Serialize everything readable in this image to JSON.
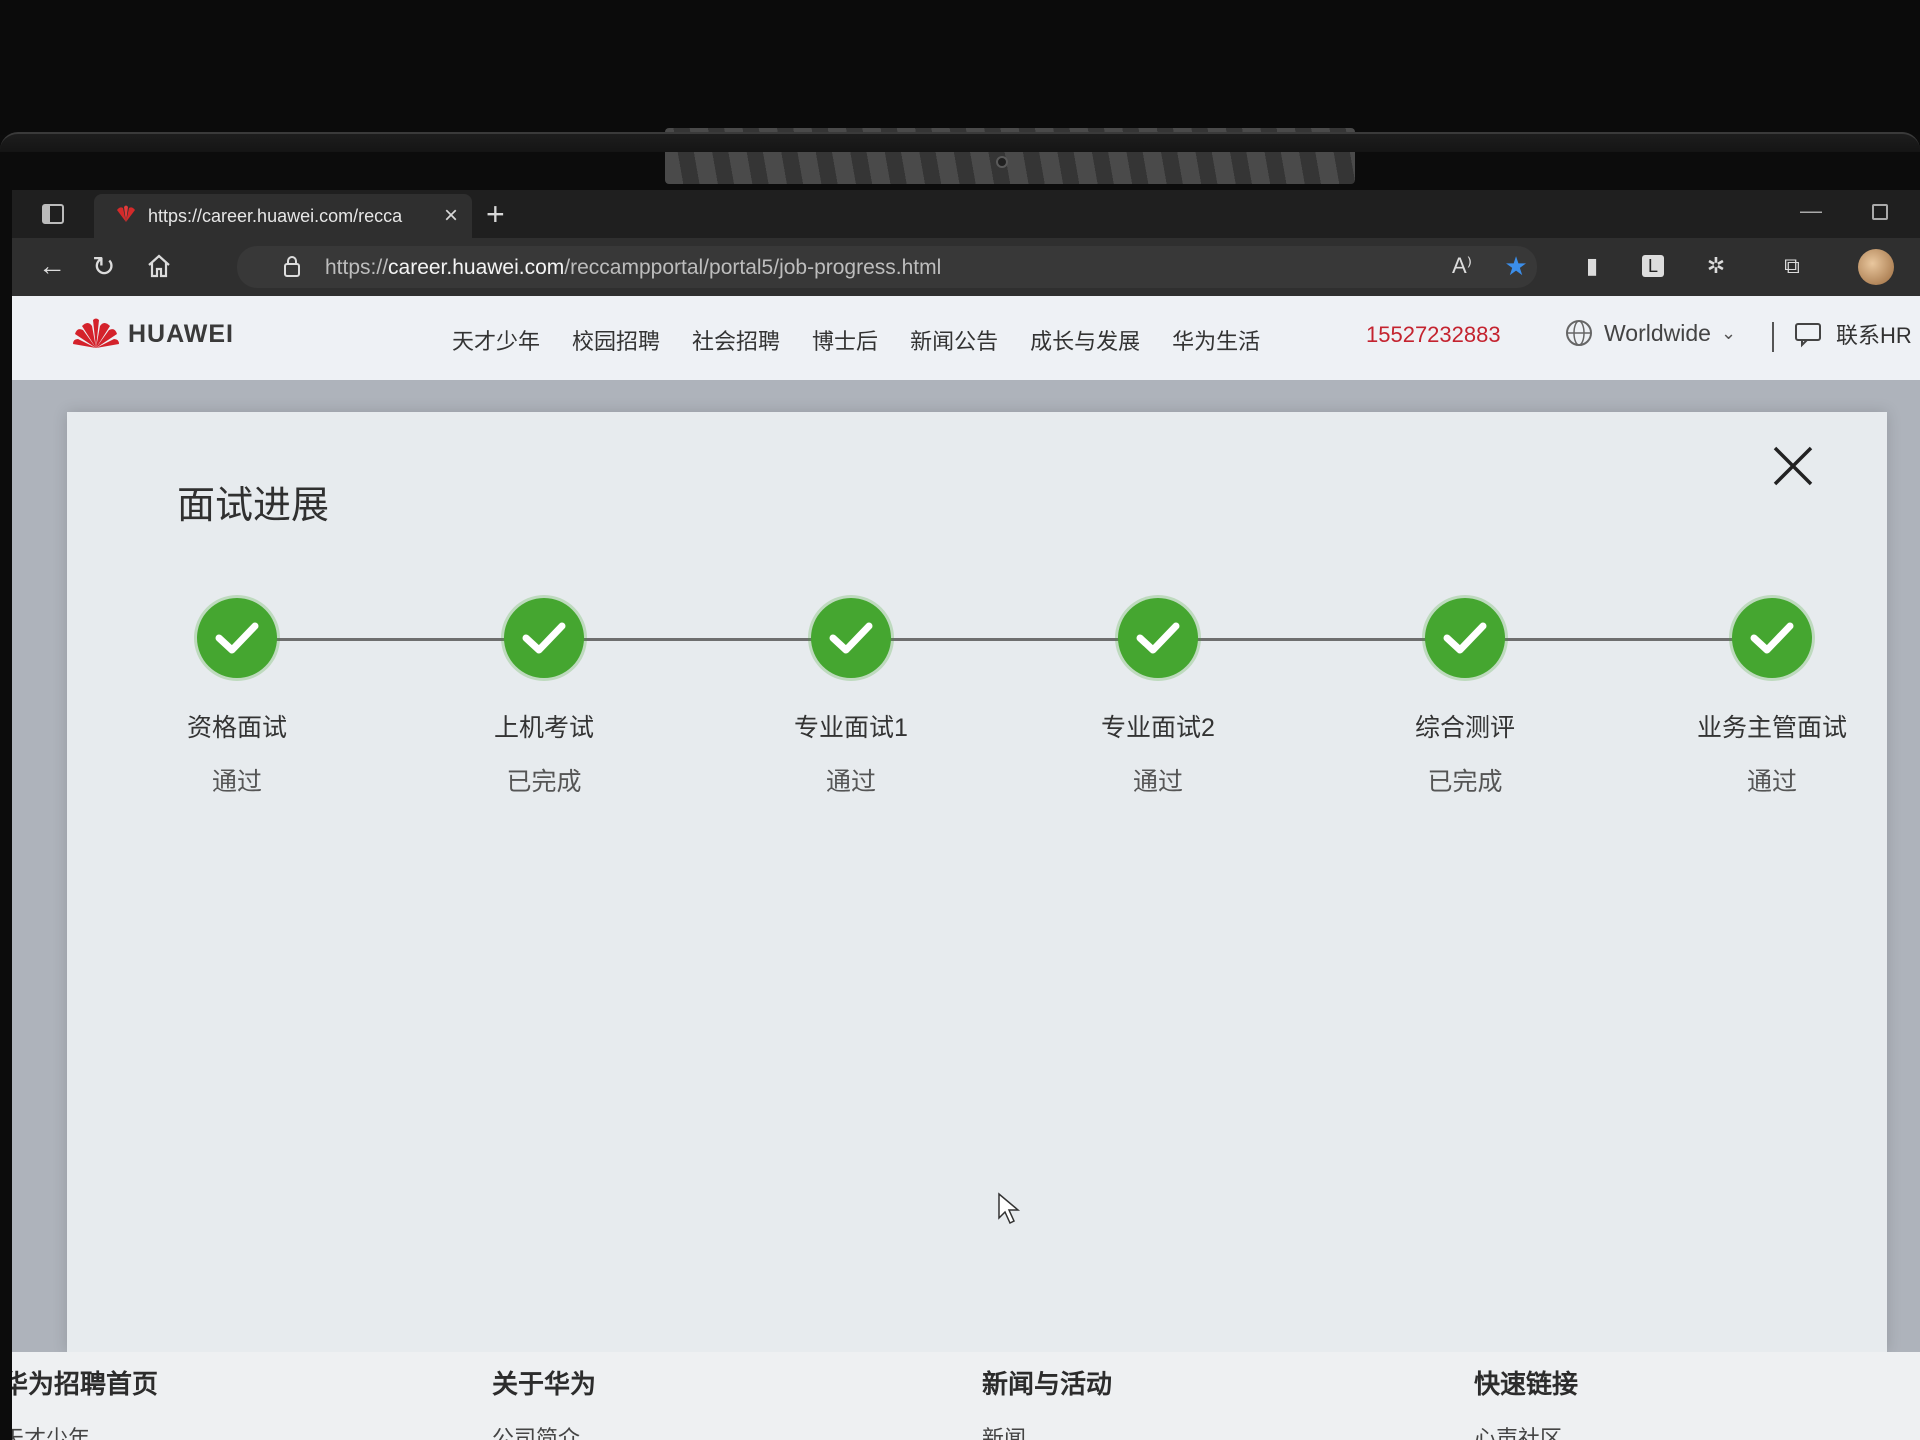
{
  "browser": {
    "tab_title": "https://career.huawei.com/recca",
    "url_prefix": "https://",
    "url_domain": "career.huawei.com",
    "url_path": "/reccampportal/portal5/job-progress.html"
  },
  "header": {
    "logo_text": "HUAWEI",
    "nav": [
      "天才少年",
      "校园招聘",
      "社会招聘",
      "博士后",
      "新闻公告",
      "成长与发展",
      "华为生活"
    ],
    "phone": "15527232883",
    "region": "Worldwide",
    "contact": "联系HR"
  },
  "modal": {
    "title": "面试进展",
    "steps": [
      {
        "name": "资格面试",
        "status": "通过"
      },
      {
        "name": "上机考试",
        "status": "已完成"
      },
      {
        "name": "专业面试1",
        "status": "通过"
      },
      {
        "name": "专业面试2",
        "status": "通过"
      },
      {
        "name": "综合测评",
        "status": "已完成"
      },
      {
        "name": "业务主管面试",
        "status": "通过"
      }
    ]
  },
  "footer": {
    "columns": [
      {
        "head": "华为招聘首页",
        "link": "天才少年"
      },
      {
        "head": "关于华为",
        "link": "公司简介"
      },
      {
        "head": "新闻与活动",
        "link": "新闻"
      },
      {
        "head": "快速链接",
        "link": "心声社区"
      }
    ]
  },
  "colors": {
    "brand_red": "#c4232f",
    "step_green": "#45a630"
  }
}
